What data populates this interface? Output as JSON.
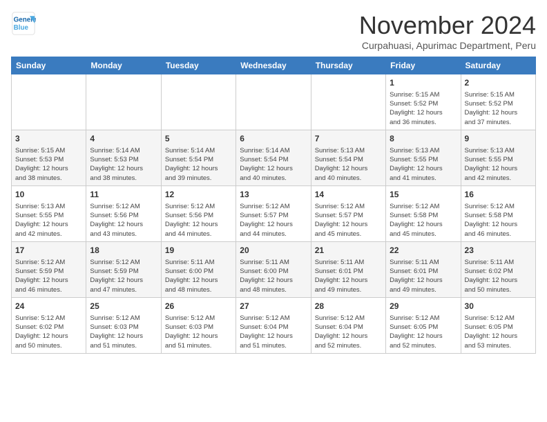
{
  "header": {
    "logo_line1": "General",
    "logo_line2": "Blue",
    "title": "November 2024",
    "subtitle": "Curpahuasi, Apurimac Department, Peru"
  },
  "days_of_week": [
    "Sunday",
    "Monday",
    "Tuesday",
    "Wednesday",
    "Thursday",
    "Friday",
    "Saturday"
  ],
  "weeks": [
    [
      {
        "day": "",
        "info": ""
      },
      {
        "day": "",
        "info": ""
      },
      {
        "day": "",
        "info": ""
      },
      {
        "day": "",
        "info": ""
      },
      {
        "day": "",
        "info": ""
      },
      {
        "day": "1",
        "info": "Sunrise: 5:15 AM\nSunset: 5:52 PM\nDaylight: 12 hours\nand 36 minutes."
      },
      {
        "day": "2",
        "info": "Sunrise: 5:15 AM\nSunset: 5:52 PM\nDaylight: 12 hours\nand 37 minutes."
      }
    ],
    [
      {
        "day": "3",
        "info": "Sunrise: 5:15 AM\nSunset: 5:53 PM\nDaylight: 12 hours\nand 38 minutes."
      },
      {
        "day": "4",
        "info": "Sunrise: 5:14 AM\nSunset: 5:53 PM\nDaylight: 12 hours\nand 38 minutes."
      },
      {
        "day": "5",
        "info": "Sunrise: 5:14 AM\nSunset: 5:54 PM\nDaylight: 12 hours\nand 39 minutes."
      },
      {
        "day": "6",
        "info": "Sunrise: 5:14 AM\nSunset: 5:54 PM\nDaylight: 12 hours\nand 40 minutes."
      },
      {
        "day": "7",
        "info": "Sunrise: 5:13 AM\nSunset: 5:54 PM\nDaylight: 12 hours\nand 40 minutes."
      },
      {
        "day": "8",
        "info": "Sunrise: 5:13 AM\nSunset: 5:55 PM\nDaylight: 12 hours\nand 41 minutes."
      },
      {
        "day": "9",
        "info": "Sunrise: 5:13 AM\nSunset: 5:55 PM\nDaylight: 12 hours\nand 42 minutes."
      }
    ],
    [
      {
        "day": "10",
        "info": "Sunrise: 5:13 AM\nSunset: 5:55 PM\nDaylight: 12 hours\nand 42 minutes."
      },
      {
        "day": "11",
        "info": "Sunrise: 5:12 AM\nSunset: 5:56 PM\nDaylight: 12 hours\nand 43 minutes."
      },
      {
        "day": "12",
        "info": "Sunrise: 5:12 AM\nSunset: 5:56 PM\nDaylight: 12 hours\nand 44 minutes."
      },
      {
        "day": "13",
        "info": "Sunrise: 5:12 AM\nSunset: 5:57 PM\nDaylight: 12 hours\nand 44 minutes."
      },
      {
        "day": "14",
        "info": "Sunrise: 5:12 AM\nSunset: 5:57 PM\nDaylight: 12 hours\nand 45 minutes."
      },
      {
        "day": "15",
        "info": "Sunrise: 5:12 AM\nSunset: 5:58 PM\nDaylight: 12 hours\nand 45 minutes."
      },
      {
        "day": "16",
        "info": "Sunrise: 5:12 AM\nSunset: 5:58 PM\nDaylight: 12 hours\nand 46 minutes."
      }
    ],
    [
      {
        "day": "17",
        "info": "Sunrise: 5:12 AM\nSunset: 5:59 PM\nDaylight: 12 hours\nand 46 minutes."
      },
      {
        "day": "18",
        "info": "Sunrise: 5:12 AM\nSunset: 5:59 PM\nDaylight: 12 hours\nand 47 minutes."
      },
      {
        "day": "19",
        "info": "Sunrise: 5:11 AM\nSunset: 6:00 PM\nDaylight: 12 hours\nand 48 minutes."
      },
      {
        "day": "20",
        "info": "Sunrise: 5:11 AM\nSunset: 6:00 PM\nDaylight: 12 hours\nand 48 minutes."
      },
      {
        "day": "21",
        "info": "Sunrise: 5:11 AM\nSunset: 6:01 PM\nDaylight: 12 hours\nand 49 minutes."
      },
      {
        "day": "22",
        "info": "Sunrise: 5:11 AM\nSunset: 6:01 PM\nDaylight: 12 hours\nand 49 minutes."
      },
      {
        "day": "23",
        "info": "Sunrise: 5:11 AM\nSunset: 6:02 PM\nDaylight: 12 hours\nand 50 minutes."
      }
    ],
    [
      {
        "day": "24",
        "info": "Sunrise: 5:12 AM\nSunset: 6:02 PM\nDaylight: 12 hours\nand 50 minutes."
      },
      {
        "day": "25",
        "info": "Sunrise: 5:12 AM\nSunset: 6:03 PM\nDaylight: 12 hours\nand 51 minutes."
      },
      {
        "day": "26",
        "info": "Sunrise: 5:12 AM\nSunset: 6:03 PM\nDaylight: 12 hours\nand 51 minutes."
      },
      {
        "day": "27",
        "info": "Sunrise: 5:12 AM\nSunset: 6:04 PM\nDaylight: 12 hours\nand 51 minutes."
      },
      {
        "day": "28",
        "info": "Sunrise: 5:12 AM\nSunset: 6:04 PM\nDaylight: 12 hours\nand 52 minutes."
      },
      {
        "day": "29",
        "info": "Sunrise: 5:12 AM\nSunset: 6:05 PM\nDaylight: 12 hours\nand 52 minutes."
      },
      {
        "day": "30",
        "info": "Sunrise: 5:12 AM\nSunset: 6:05 PM\nDaylight: 12 hours\nand 53 minutes."
      }
    ]
  ]
}
